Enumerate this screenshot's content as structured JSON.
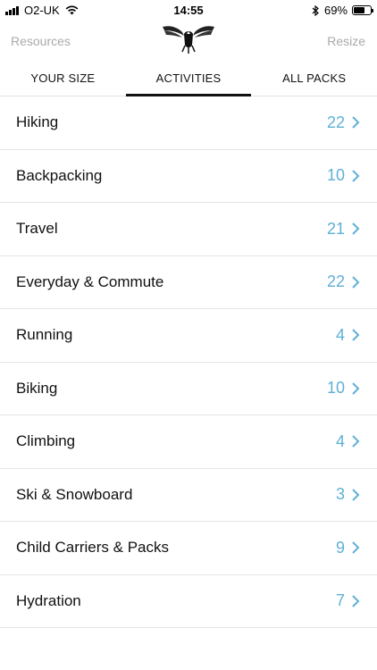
{
  "status": {
    "carrier": "O2-UK",
    "time": "14:55",
    "battery": "69%",
    "battery_level": 0.69
  },
  "nav": {
    "left_label": "Resources",
    "right_label": "Resize",
    "logo_icon": "osprey-logo-icon"
  },
  "tabs": [
    {
      "label": "YOUR SIZE",
      "active": false
    },
    {
      "label": "ACTIVITIES",
      "active": true
    },
    {
      "label": "ALL PACKS",
      "active": false
    }
  ],
  "activities": [
    {
      "label": "Hiking",
      "count": "22"
    },
    {
      "label": "Backpacking",
      "count": "10"
    },
    {
      "label": "Travel",
      "count": "21"
    },
    {
      "label": "Everyday & Commute",
      "count": "22"
    },
    {
      "label": "Running",
      "count": "4"
    },
    {
      "label": "Biking",
      "count": "10"
    },
    {
      "label": "Climbing",
      "count": "4"
    },
    {
      "label": "Ski & Snowboard",
      "count": "3"
    },
    {
      "label": "Child Carriers & Packs",
      "count": "9"
    },
    {
      "label": "Hydration",
      "count": "7"
    }
  ],
  "colors": {
    "accent": "#5fb0d6",
    "nav_text": "#aaaaaa",
    "divider": "#e4e4e4"
  }
}
